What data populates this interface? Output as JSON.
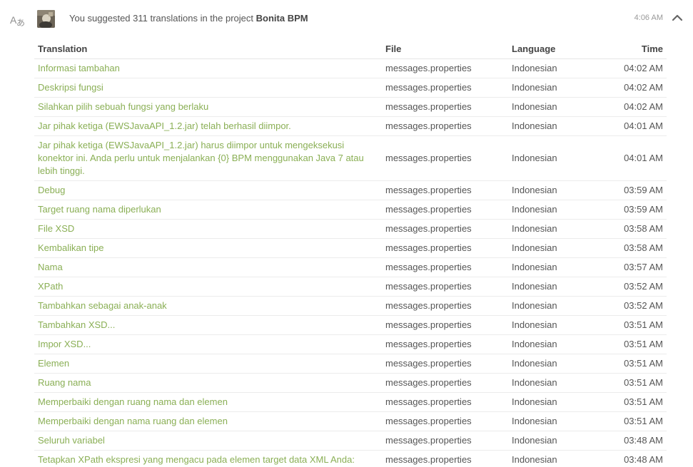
{
  "activity": {
    "summary_prefix": "You suggested 311 translations in the project",
    "project": "Bonita BPM",
    "time": "4:06 AM",
    "icons": {
      "type": "translate-icon",
      "collapse": "chevron-up-icon"
    }
  },
  "table": {
    "headers": {
      "translation": "Translation",
      "file": "File",
      "language": "Language",
      "time": "Time"
    },
    "rows": [
      {
        "translation": "Informasi tambahan",
        "file": "messages.properties",
        "language": "Indonesian",
        "time": "04:02 AM"
      },
      {
        "translation": "Deskripsi fungsi",
        "file": "messages.properties",
        "language": "Indonesian",
        "time": "04:02 AM"
      },
      {
        "translation": "Silahkan pilih sebuah fungsi yang berlaku",
        "file": "messages.properties",
        "language": "Indonesian",
        "time": "04:02 AM"
      },
      {
        "translation": "Jar pihak ketiga (EWSJavaAPI_1.2.jar) telah berhasil diimpor.",
        "file": "messages.properties",
        "language": "Indonesian",
        "time": "04:01 AM"
      },
      {
        "translation": "Jar pihak ketiga (EWSJavaAPI_1.2.jar) harus diimpor untuk mengeksekusi konektor ini. Anda perlu untuk menjalankan {0} BPM menggunakan Java 7 atau lebih tinggi.",
        "file": "messages.properties",
        "language": "Indonesian",
        "time": "04:01 AM"
      },
      {
        "translation": "Debug",
        "file": "messages.properties",
        "language": "Indonesian",
        "time": "03:59 AM"
      },
      {
        "translation": "Target ruang nama diperlukan",
        "file": "messages.properties",
        "language": "Indonesian",
        "time": "03:59 AM"
      },
      {
        "translation": "File XSD",
        "file": "messages.properties",
        "language": "Indonesian",
        "time": "03:58 AM"
      },
      {
        "translation": "Kembalikan tipe",
        "file": "messages.properties",
        "language": "Indonesian",
        "time": "03:58 AM"
      },
      {
        "translation": "Nama",
        "file": "messages.properties",
        "language": "Indonesian",
        "time": "03:57 AM"
      },
      {
        "translation": "XPath",
        "file": "messages.properties",
        "language": "Indonesian",
        "time": "03:52 AM"
      },
      {
        "translation": "Tambahkan sebagai anak-anak",
        "file": "messages.properties",
        "language": "Indonesian",
        "time": "03:52 AM"
      },
      {
        "translation": "Tambahkan XSD...",
        "file": "messages.properties",
        "language": "Indonesian",
        "time": "03:51 AM"
      },
      {
        "translation": "Impor XSD...",
        "file": "messages.properties",
        "language": "Indonesian",
        "time": "03:51 AM"
      },
      {
        "translation": "Elemen",
        "file": "messages.properties",
        "language": "Indonesian",
        "time": "03:51 AM"
      },
      {
        "translation": "Ruang nama",
        "file": "messages.properties",
        "language": "Indonesian",
        "time": "03:51 AM"
      },
      {
        "translation": "Memperbaiki dengan ruang nama dan elemen",
        "file": "messages.properties",
        "language": "Indonesian",
        "time": "03:51 AM"
      },
      {
        "translation": "Memperbaiki dengan nama ruang dan elemen",
        "file": "messages.properties",
        "language": "Indonesian",
        "time": "03:51 AM"
      },
      {
        "translation": "Seluruh variabel",
        "file": "messages.properties",
        "language": "Indonesian",
        "time": "03:48 AM"
      },
      {
        "translation": "Tetapkan XPath ekspresi yang mengacu pada elemen target data XML Anda:",
        "file": "messages.properties",
        "language": "Indonesian",
        "time": "03:48 AM"
      }
    ]
  },
  "colors": {
    "link": "#8aaf55",
    "text": "#555555",
    "muted": "#999999",
    "border": "#ececec"
  }
}
